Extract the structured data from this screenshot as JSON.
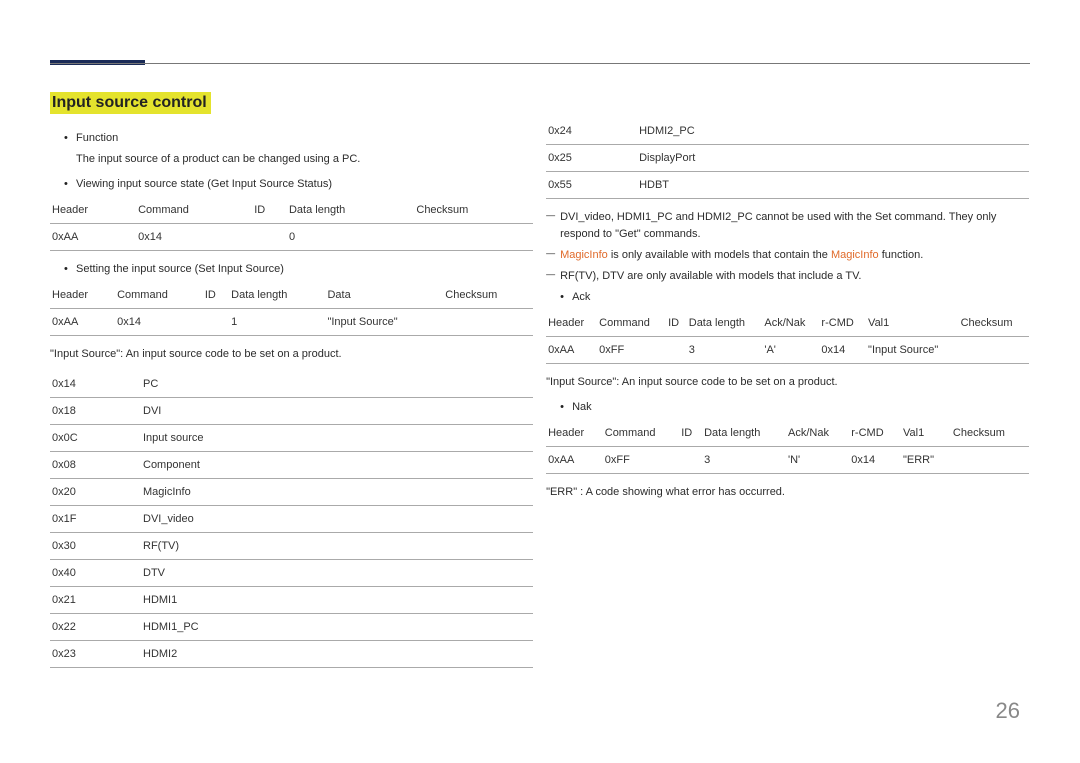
{
  "page_number": "26",
  "section_title": "Input source control",
  "left": {
    "function_label": "Function",
    "function_desc": "The input source of a product can be changed using a PC.",
    "viewing_label": "Viewing input source state (Get Input Source Status)",
    "get_table": {
      "h": [
        "Header",
        "Command",
        "ID",
        "Data length",
        "Checksum"
      ],
      "r": [
        "0xAA",
        "0x14",
        "",
        "0",
        ""
      ]
    },
    "setting_label": "Setting the input source (Set Input Source)",
    "set_table": {
      "h": [
        "Header",
        "Command",
        "ID",
        "Data length",
        "Data",
        "Checksum"
      ],
      "r": [
        "0xAA",
        "0x14",
        "",
        "1",
        "\"Input Source\"",
        ""
      ]
    },
    "input_source_def": "\"Input Source\": An input source code to be set on a product.",
    "codes": [
      [
        "0x14",
        "PC"
      ],
      [
        "0x18",
        "DVI"
      ],
      [
        "0x0C",
        "Input source"
      ],
      [
        "0x08",
        "Component"
      ],
      [
        "0x20",
        "MagicInfo"
      ],
      [
        "0x1F",
        "DVI_video"
      ],
      [
        "0x30",
        "RF(TV)"
      ],
      [
        "0x40",
        "DTV"
      ],
      [
        "0x21",
        "HDMI1"
      ],
      [
        "0x22",
        "HDMI1_PC"
      ],
      [
        "0x23",
        "HDMI2"
      ]
    ]
  },
  "right": {
    "codes": [
      [
        "0x24",
        "HDMI2_PC"
      ],
      [
        "0x25",
        "DisplayPort"
      ],
      [
        "0x55",
        "HDBT"
      ]
    ],
    "note1": "DVI_video, HDMI1_PC and HDMI2_PC cannot be used with the Set command. They only respond to \"Get\" commands.",
    "note2_a": "MagicInfo",
    "note2_b": " is only available with models that contain the ",
    "note2_c": "MagicInfo",
    "note2_d": " function.",
    "note3": "RF(TV), DTV are only available with models that include a TV.",
    "ack_label": "Ack",
    "ack_table": {
      "h": [
        "Header",
        "Command",
        "ID",
        "Data length",
        "Ack/Nak",
        "r-CMD",
        "Val1",
        "Checksum"
      ],
      "r": [
        "0xAA",
        "0xFF",
        "",
        "3",
        "'A'",
        "0x14",
        "\"Input Source\"",
        ""
      ]
    },
    "ack_def": "\"Input Source\": An input source code to be set on a product.",
    "nak_label": "Nak",
    "nak_table": {
      "h": [
        "Header",
        "Command",
        "ID",
        "Data length",
        "Ack/Nak",
        "r-CMD",
        "Val1",
        "Checksum"
      ],
      "r": [
        "0xAA",
        "0xFF",
        "",
        "3",
        "'N'",
        "0x14",
        "\"ERR\"",
        ""
      ]
    },
    "err_def": "\"ERR\" : A code showing what error has occurred."
  }
}
